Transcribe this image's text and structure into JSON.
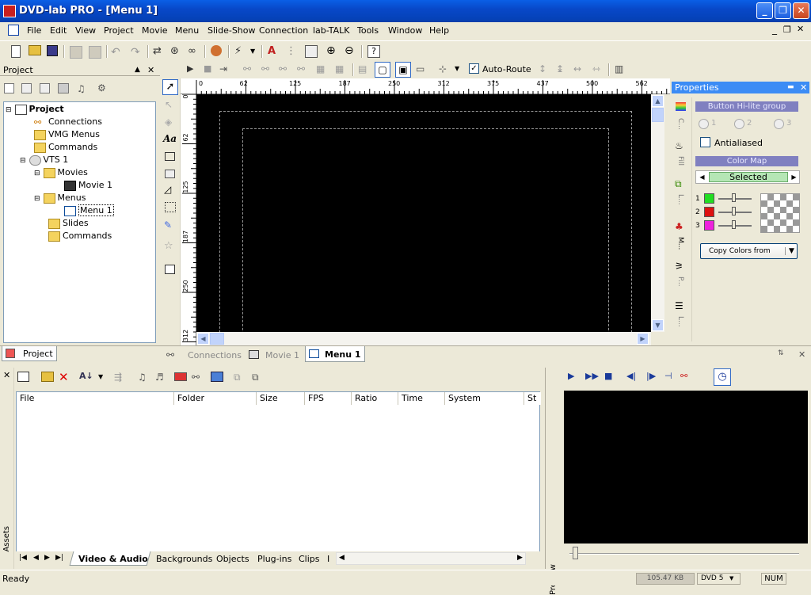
{
  "window": {
    "title": "DVD-lab PRO  - [Menu 1]"
  },
  "menu": [
    "File",
    "Edit",
    "View",
    "Project",
    "Movie",
    "Menu",
    "Slide-Show",
    "Connection",
    "lab-TALK",
    "Tools",
    "Window",
    "Help"
  ],
  "toolbar": {
    "auto_route_label": "Auto-Route",
    "auto_route_checked": true
  },
  "project_panel": {
    "title": "Project",
    "tree": [
      "Project",
      "Connections",
      "VMG Menus",
      "Commands",
      "VTS 1",
      "Movies",
      "Movie 1",
      "Menus",
      "Menu 1",
      "Slides",
      "Commands"
    ],
    "bottom_tab": "Project"
  },
  "ruler": {
    "h_ticks": [
      "0",
      "62",
      "125",
      "187",
      "250",
      "312",
      "375",
      "437",
      "500",
      "562",
      "625",
      "687"
    ],
    "v_ticks": [
      "0",
      "62",
      "125",
      "187",
      "250",
      "312",
      "375"
    ]
  },
  "doc_tabs": [
    "Connections",
    "Movie 1",
    "Menu 1"
  ],
  "properties": {
    "title": "Properties",
    "button_state_group": "Button Hi-lite group",
    "radio_labels": [
      "1",
      "2",
      "3"
    ],
    "antialiased_label": "Antialiased",
    "color_map_label": "Color Map",
    "selected_label": "Selected",
    "color_rows": [
      {
        "index": "1",
        "color": "#22dd22"
      },
      {
        "index": "2",
        "color": "#dd1111"
      },
      {
        "index": "3",
        "color": "#ee22dd"
      }
    ],
    "copy_colors_label": "Copy Colors from",
    "side_tabs": [
      "C...",
      "Fill",
      "L...",
      "M...",
      "P...",
      "L..."
    ]
  },
  "assets": {
    "side_label": "Assets",
    "columns": [
      "File",
      "Folder",
      "Size",
      "FPS",
      "Ratio",
      "Time",
      "System",
      "St"
    ],
    "tabs": [
      "Video & Audio",
      "Backgrounds",
      "Objects",
      "Plug-ins",
      "Clips",
      "I"
    ]
  },
  "preview": {
    "side_label": "Preview"
  },
  "status": {
    "text": "Ready",
    "memory": "105.47 KB",
    "disc": "DVD 5",
    "num": "NUM"
  }
}
